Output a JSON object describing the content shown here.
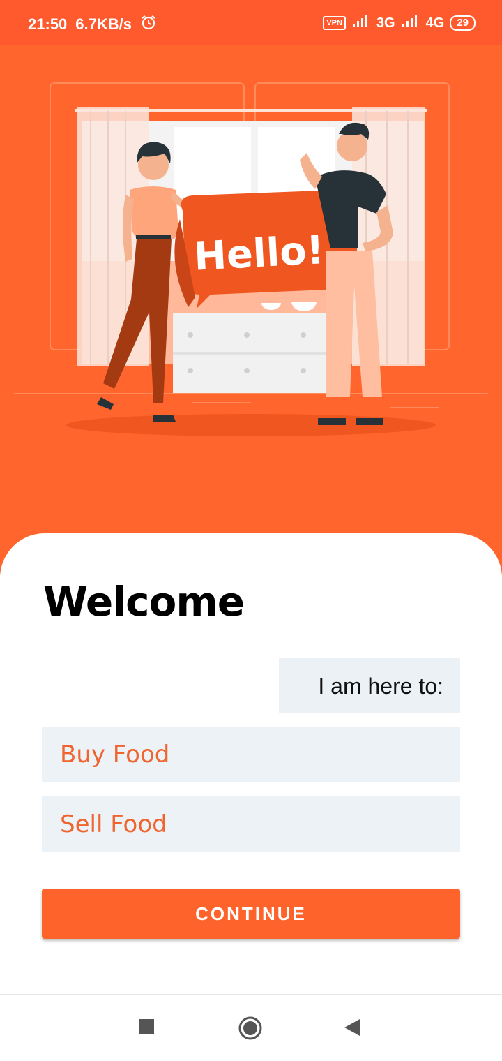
{
  "status_bar": {
    "time": "21:50",
    "speed": "6.7KB/s",
    "vpn": "VPN",
    "network1": "3G",
    "network2": "4G",
    "battery": "29"
  },
  "hero": {
    "speech_bubble_text": "Hello!"
  },
  "welcome": {
    "title": "Welcome",
    "prompt": "I am here to:"
  },
  "options": {
    "buy_label": "Buy Food",
    "sell_label": "Sell Food"
  },
  "actions": {
    "continue_label": "CONTINUE"
  },
  "colors": {
    "accent": "#ff652c",
    "status_bar": "#ff5a2e",
    "option_bg": "#ecf2f6",
    "option_text": "#f0652f"
  },
  "nav": {
    "icons": [
      "recents-square-icon",
      "home-circle-icon",
      "back-triangle-icon"
    ]
  }
}
